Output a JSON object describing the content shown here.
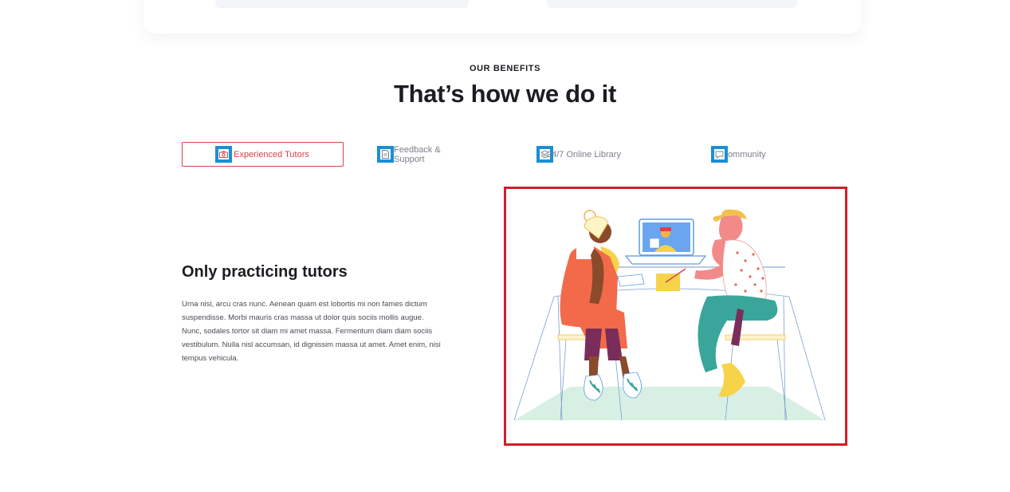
{
  "section": {
    "eyebrow": "OUR BENEFITS",
    "headline": "That’s how we do it"
  },
  "tabs": [
    {
      "label": "Experienced Tutors",
      "icon": "camera-icon",
      "active": true
    },
    {
      "label": "Feedback & Support",
      "icon": "document-icon",
      "active": false
    },
    {
      "label": "24/7 Online Library",
      "icon": "layers-icon",
      "active": false
    },
    {
      "label": "Community",
      "icon": "chat-icon",
      "active": false
    }
  ],
  "content": {
    "title": "Only practicing tutors",
    "body": "Urna nisi, arcu cras nunc. Aenean quam est lobortis mi non fames dictum suspendisse. Morbi mauris cras massa ut dolor quis sociis mollis augue. Nunc, sodales tortor sit diam mi amet massa. Fermentum diam diam sociis vestibulum. Nulla nisl accumsan, id dignissim massa ut amet. Amet enim, nisi tempus vehicula."
  },
  "colors": {
    "accent": "#d9434b",
    "icon_highlight": "#1a8fd6",
    "illustration_border": "#d01f2a"
  }
}
